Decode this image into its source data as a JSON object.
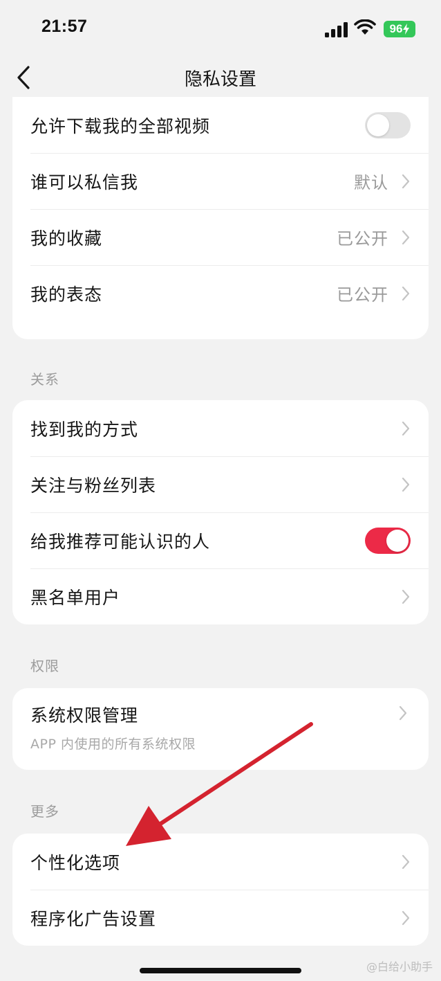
{
  "status_bar": {
    "time": "21:57",
    "battery": "96"
  },
  "nav": {
    "title": "隐私设置"
  },
  "group1": {
    "items": [
      {
        "label": "允许下载我的全部视频",
        "toggle": "off"
      },
      {
        "label": "谁可以私信我",
        "value": "默认"
      },
      {
        "label": "我的收藏",
        "value": "已公开"
      },
      {
        "label": "我的表态",
        "value": "已公开"
      }
    ]
  },
  "relations": {
    "header": "关系",
    "items": [
      {
        "label": "找到我的方式"
      },
      {
        "label": "关注与粉丝列表"
      },
      {
        "label": "给我推荐可能认识的人",
        "toggle": "on"
      },
      {
        "label": "黑名单用户"
      }
    ]
  },
  "permissions": {
    "header": "权限",
    "items": [
      {
        "label": "系统权限管理",
        "sublabel": "APP 内使用的所有系统权限"
      }
    ]
  },
  "more": {
    "header": "更多",
    "items": [
      {
        "label": "个性化选项"
      },
      {
        "label": "程序化广告设置"
      }
    ]
  },
  "colors": {
    "accent": "#ec2a47",
    "arrow": "#d4232f",
    "battery": "#34c759"
  },
  "watermark": "@白给小助手"
}
